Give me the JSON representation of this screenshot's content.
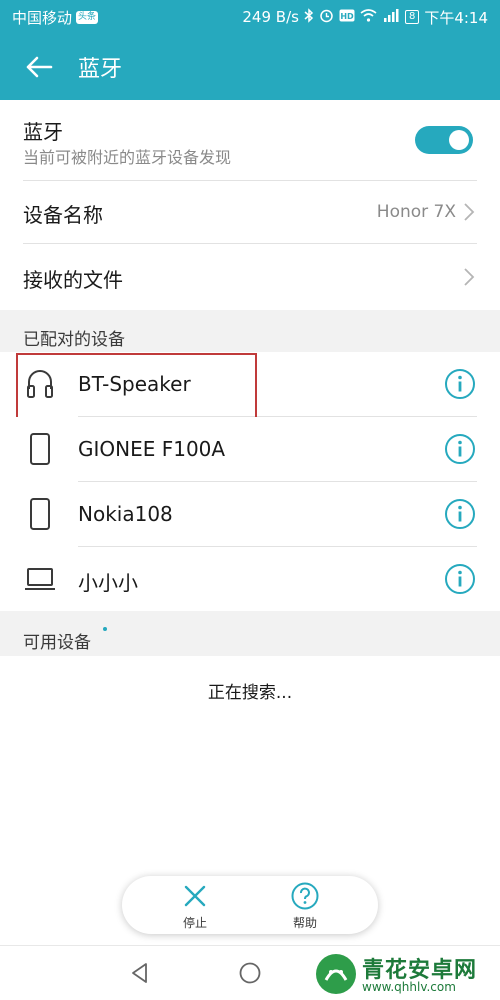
{
  "status_bar": {
    "carrier": "中国移动",
    "carrier_badge": "头条",
    "speed": "249 B/s",
    "battery": "8",
    "time": "下午4:14"
  },
  "app_bar": {
    "title": "蓝牙"
  },
  "bluetooth": {
    "title": "蓝牙",
    "subtitle": "当前可被附近的蓝牙设备发现",
    "enabled": true
  },
  "device_name_row": {
    "label": "设备名称",
    "value": "Honor 7X"
  },
  "received_files_row": {
    "label": "接收的文件"
  },
  "paired_section": {
    "header": "已配对的设备",
    "devices": [
      {
        "name": "BT-Speaker",
        "icon": "headphones-icon"
      },
      {
        "name": "GIONEE F100A",
        "icon": "phone-icon"
      },
      {
        "name": "Nokia108",
        "icon": "phone-icon"
      },
      {
        "name": "小小小",
        "icon": "laptop-icon"
      }
    ]
  },
  "available_section": {
    "header": "可用设备",
    "status": "正在搜索..."
  },
  "toolbar": {
    "stop_label": "停止",
    "help_label": "帮助"
  },
  "watermark": {
    "text": "青花安卓网",
    "url": "www.qhhlv.com"
  },
  "colors": {
    "accent": "#26a9be",
    "highlight": "#c03a3a",
    "watermark": "#1d7a3a"
  }
}
